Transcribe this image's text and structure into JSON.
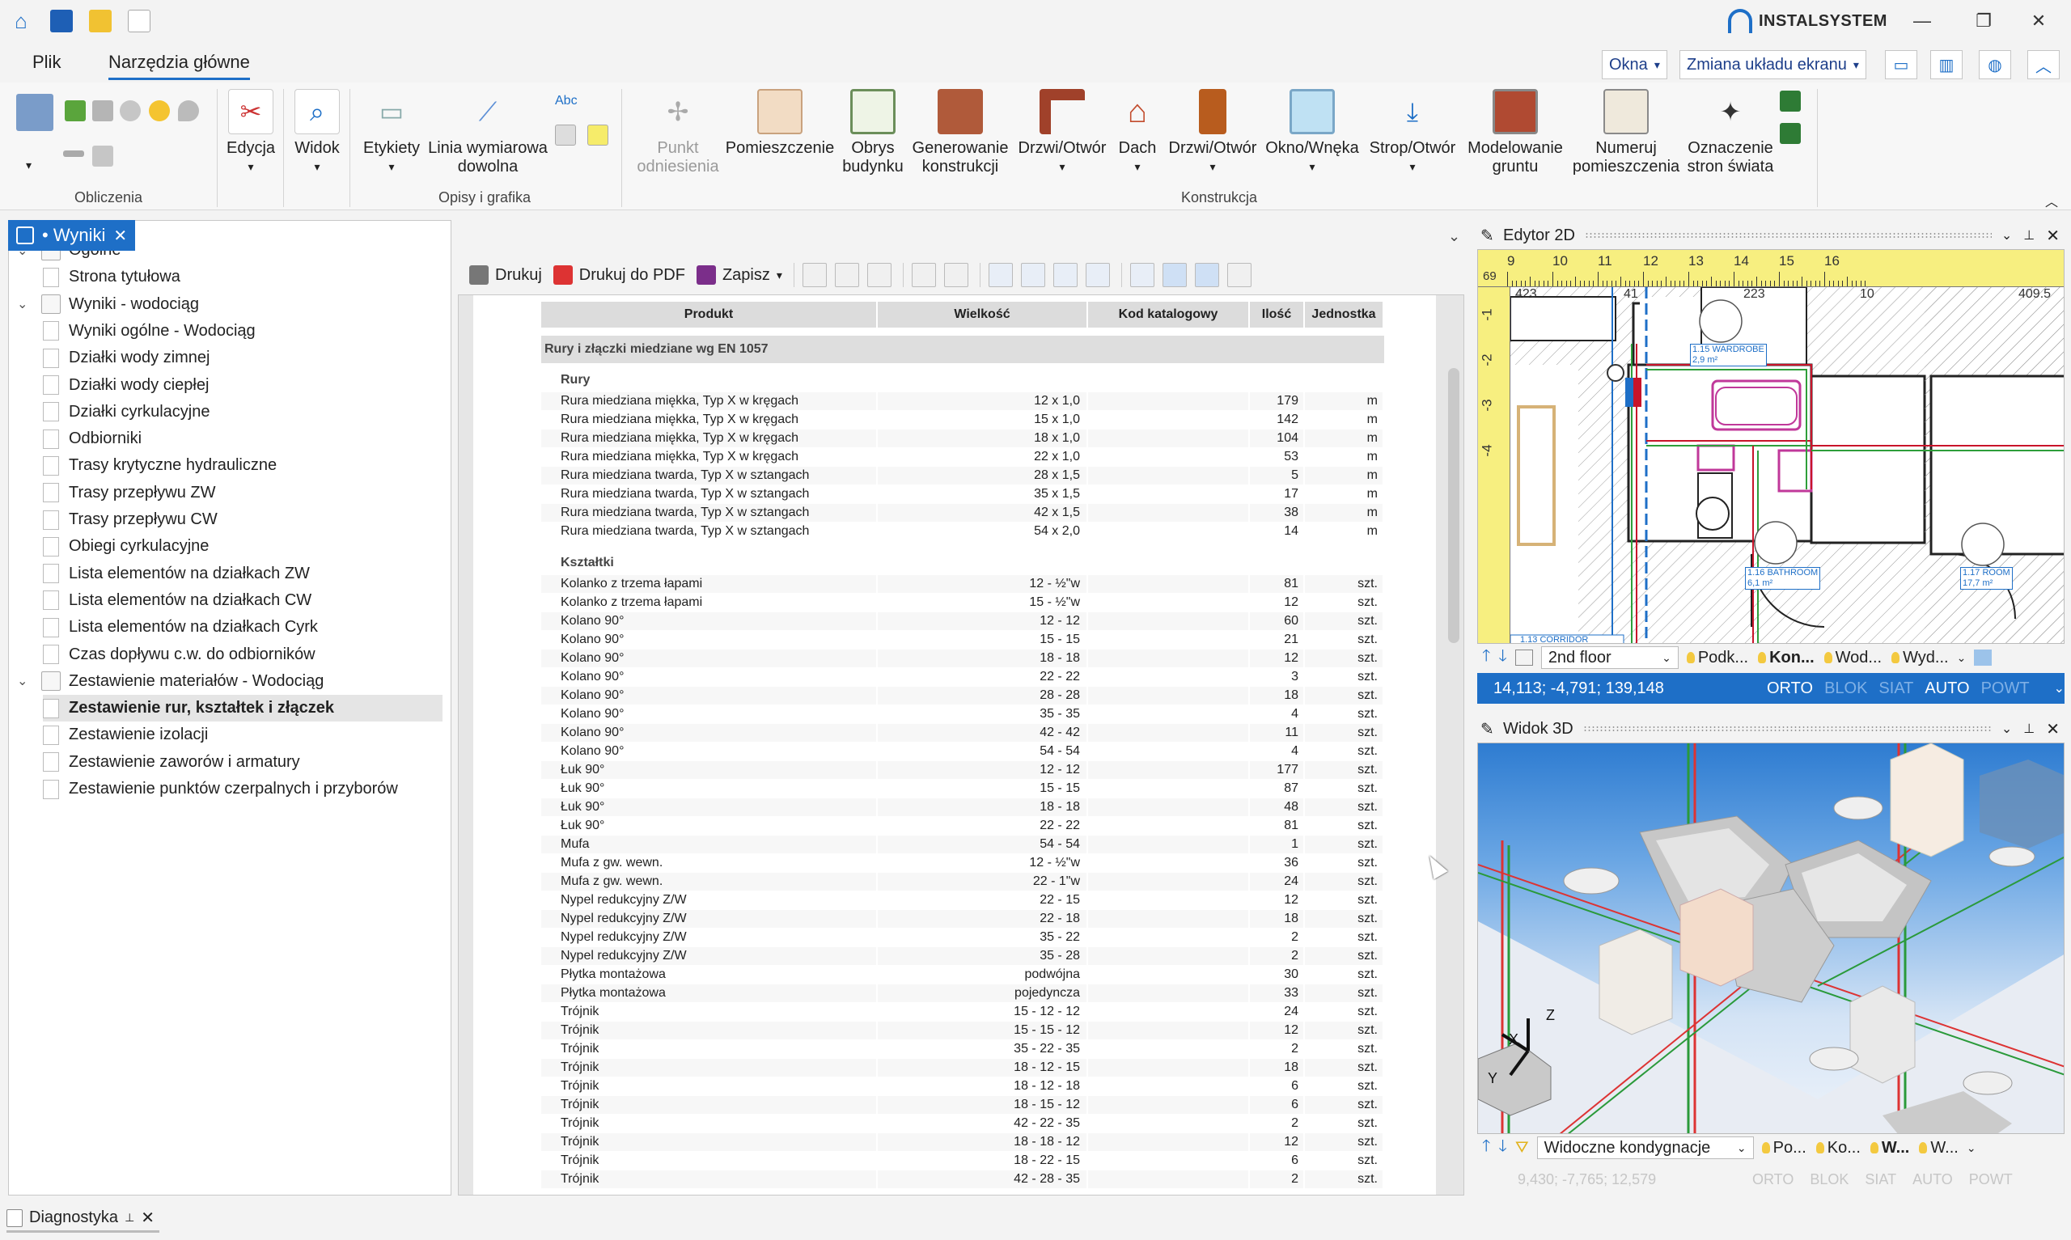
{
  "brand": "INSTALSYSTEM",
  "menu": {
    "tabs": [
      {
        "label": "Plik"
      },
      {
        "label": "Narzędzia główne"
      }
    ]
  },
  "topright": {
    "okna": "Okna",
    "zmiana": "Zmiana układu ekranu"
  },
  "ribbon": {
    "groups": {
      "obliczenia": "Obliczenia",
      "opisy": "Opisy i grafika",
      "konstrukcja": "Konstrukcja"
    },
    "buttons": {
      "edycja": "Edycja",
      "widok": "Widok",
      "etykiety": "Etykiety",
      "linia1": "Linia wymiarowa",
      "linia2": "dowolna",
      "abc": "Abc",
      "punkt1": "Punkt",
      "punkt2": "odniesienia",
      "pomieszczenie": "Pomieszczenie",
      "obrys1": "Obrys",
      "obrys2": "budynku",
      "gen1": "Generowanie",
      "gen2": "konstrukcji",
      "drzwi1": "Drzwi/Otwór",
      "dach": "Dach",
      "drzwi2": "Drzwi/Otwór",
      "okno": "Okno/Wnęka",
      "strop": "Strop/Otwór",
      "model1": "Modelowanie",
      "model2": "gruntu",
      "num1": "Numeruj",
      "num2": "pomieszczenia",
      "ozn1": "Oznaczenie",
      "ozn2": "stron świata"
    }
  },
  "leftpanel": {
    "tab": "• Wyniki",
    "tree": [
      {
        "label": "Ogólne",
        "level": 0
      },
      {
        "label": "Strona tytułowa",
        "level": 1
      },
      {
        "label": "Wyniki - wodociąg",
        "level": 0
      },
      {
        "label": "Wyniki ogólne - Wodociąg",
        "level": 1
      },
      {
        "label": "Działki wody zimnej",
        "level": 1
      },
      {
        "label": "Działki wody ciepłej",
        "level": 1
      },
      {
        "label": "Działki cyrkulacyjne",
        "level": 1
      },
      {
        "label": "Odbiorniki",
        "level": 1
      },
      {
        "label": "Trasy krytyczne hydrauliczne",
        "level": 1
      },
      {
        "label": "Trasy przepływu ZW",
        "level": 1
      },
      {
        "label": "Trasy przepływu CW",
        "level": 1
      },
      {
        "label": "Obiegi cyrkulacyjne",
        "level": 1
      },
      {
        "label": "Lista elementów na działkach ZW",
        "level": 1
      },
      {
        "label": "Lista elementów na działkach CW",
        "level": 1
      },
      {
        "label": "Lista elementów na działkach Cyrk",
        "level": 1
      },
      {
        "label": "Czas dopływu c.w. do odbiorników",
        "level": 1
      },
      {
        "label": "Zestawienie materiałów - Wodociąg",
        "level": 0
      },
      {
        "label": "Zestawienie rur, kształtek i złączek",
        "level": 1
      },
      {
        "label": "Zestawienie izolacji",
        "level": 1
      },
      {
        "label": "Zestawienie zaworów i armatury",
        "level": 1
      },
      {
        "label": "Zestawienie punktów czerpalnych i przyborów",
        "level": 1
      }
    ]
  },
  "report": {
    "toolbar": {
      "drukuj": "Drukuj",
      "pdf": "Drukuj do PDF",
      "zapisz": "Zapisz"
    },
    "headers": [
      "Produkt",
      "Wielkość",
      "Kod katalogowy",
      "Ilość",
      "Jednostka"
    ],
    "section": "Rury i złączki miedziane wg EN 1057",
    "rury_title": "Rury",
    "rury": [
      [
        "Rura miedziana miękka, Typ X w kręgach",
        "12 x 1,0",
        "",
        "179",
        "m"
      ],
      [
        "Rura miedziana miękka, Typ X w kręgach",
        "15 x 1,0",
        "",
        "142",
        "m"
      ],
      [
        "Rura miedziana miękka, Typ X w kręgach",
        "18 x 1,0",
        "",
        "104",
        "m"
      ],
      [
        "Rura miedziana miękka, Typ X w kręgach",
        "22 x 1,0",
        "",
        "53",
        "m"
      ],
      [
        "Rura miedziana twarda, Typ X w sztangach",
        "28 x 1,5",
        "",
        "5",
        "m"
      ],
      [
        "Rura miedziana twarda, Typ X w sztangach",
        "35 x 1,5",
        "",
        "17",
        "m"
      ],
      [
        "Rura miedziana twarda, Typ X w sztangach",
        "42 x 1,5",
        "",
        "38",
        "m"
      ],
      [
        "Rura miedziana twarda, Typ X w sztangach",
        "54 x 2,0",
        "",
        "14",
        "m"
      ]
    ],
    "ksztaltki_title": "Kształtki",
    "ksztaltki": [
      [
        "Kolanko z trzema łapami",
        "12 - ½\"w",
        "",
        "81",
        "szt."
      ],
      [
        "Kolanko z trzema łapami",
        "15 - ½\"w",
        "",
        "12",
        "szt."
      ],
      [
        "Kolano 90°",
        "12 - 12",
        "",
        "60",
        "szt."
      ],
      [
        "Kolano 90°",
        "15 - 15",
        "",
        "21",
        "szt."
      ],
      [
        "Kolano 90°",
        "18 - 18",
        "",
        "12",
        "szt."
      ],
      [
        "Kolano 90°",
        "22 - 22",
        "",
        "3",
        "szt."
      ],
      [
        "Kolano 90°",
        "28 - 28",
        "",
        "18",
        "szt."
      ],
      [
        "Kolano 90°",
        "35 - 35",
        "",
        "4",
        "szt."
      ],
      [
        "Kolano 90°",
        "42 - 42",
        "",
        "11",
        "szt."
      ],
      [
        "Kolano 90°",
        "54 - 54",
        "",
        "4",
        "szt."
      ],
      [
        "Łuk 90°",
        "12 - 12",
        "",
        "177",
        "szt."
      ],
      [
        "Łuk 90°",
        "15 - 15",
        "",
        "87",
        "szt."
      ],
      [
        "Łuk 90°",
        "18 - 18",
        "",
        "48",
        "szt."
      ],
      [
        "Łuk 90°",
        "22 - 22",
        "",
        "81",
        "szt."
      ],
      [
        "Mufa",
        "54 - 54",
        "",
        "1",
        "szt."
      ],
      [
        "Mufa z gw. wewn.",
        "12 - ½\"w",
        "",
        "36",
        "szt."
      ],
      [
        "Mufa z gw. wewn.",
        "22 - 1\"w",
        "",
        "24",
        "szt."
      ],
      [
        "Nypel redukcyjny Z/W",
        "22 - 15",
        "",
        "12",
        "szt."
      ],
      [
        "Nypel redukcyjny Z/W",
        "22 - 18",
        "",
        "18",
        "szt."
      ],
      [
        "Nypel redukcyjny Z/W",
        "35 - 22",
        "",
        "2",
        "szt."
      ],
      [
        "Nypel redukcyjny Z/W",
        "35 - 28",
        "",
        "2",
        "szt."
      ],
      [
        "Płytka montażowa",
        "podwójna",
        "",
        "30",
        "szt."
      ],
      [
        "Płytka montażowa",
        "pojedyncza",
        "",
        "33",
        "szt."
      ],
      [
        "Trójnik",
        "15 - 12 - 12",
        "",
        "24",
        "szt."
      ],
      [
        "Trójnik",
        "15 - 15 - 12",
        "",
        "12",
        "szt."
      ],
      [
        "Trójnik",
        "35 - 22 - 35",
        "",
        "2",
        "szt."
      ],
      [
        "Trójnik",
        "18 - 12 - 15",
        "",
        "18",
        "szt."
      ],
      [
        "Trójnik",
        "18 - 12 - 18",
        "",
        "6",
        "szt."
      ],
      [
        "Trójnik",
        "18 - 15 - 12",
        "",
        "6",
        "szt."
      ],
      [
        "Trójnik",
        "42 - 22 - 35",
        "",
        "2",
        "szt."
      ],
      [
        "Trójnik",
        "18 - 18 - 12",
        "",
        "12",
        "szt."
      ],
      [
        "Trójnik",
        "18 - 22 - 15",
        "",
        "6",
        "szt."
      ],
      [
        "Trójnik",
        "42 - 28 - 35",
        "",
        "2",
        "szt."
      ]
    ]
  },
  "editor2d": {
    "title": "Edytor 2D",
    "ruler_top": [
      "9",
      "10",
      "11",
      "12",
      "13",
      "14",
      "15",
      "16"
    ],
    "ruler_left": [
      "-1",
      "-2",
      "-3",
      "-4"
    ],
    "ruler_corner": "69",
    "dims": {
      "d1": "423",
      "d2": "41",
      "d3": "223",
      "d4": "10",
      "d5": "409.5"
    },
    "rooms": {
      "wardrobe": "1.15 WARDROBE",
      "wardrobe_a": "2,9 m²",
      "bath": "1.16 BATHROOM",
      "bath_a": "6,1 m²",
      "room": "1.17 ROOM",
      "room_a": "17,7 m²",
      "corridor": "1.13 CORRIDOR"
    },
    "floor": "2nd floor",
    "layers": [
      "Podk...",
      "Kon...",
      "Wod...",
      "Wyd..."
    ],
    "coords": "14,113; -4,791; 139,148",
    "status": [
      "ORTO",
      "BLOK",
      "SIAT",
      "AUTO",
      "POWT"
    ]
  },
  "view3d": {
    "title": "Widok 3D",
    "combo": "Widoczne kondygnacje",
    "layers": [
      "Po...",
      "Ko...",
      "W...",
      "W..."
    ],
    "coords": "9,430; -7,765; 12,579",
    "status": [
      "ORTO",
      "BLOK",
      "SIAT",
      "AUTO",
      "POWT"
    ],
    "axes": {
      "x": "X",
      "y": "Y",
      "z": "Z"
    }
  },
  "bottom": {
    "diag": "Diagnostyka"
  }
}
